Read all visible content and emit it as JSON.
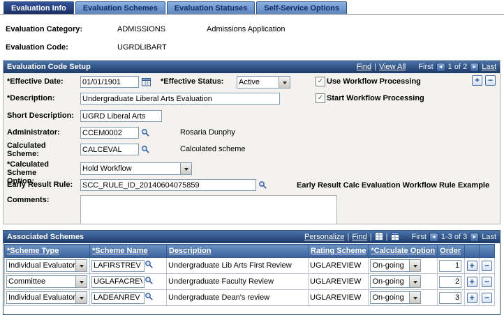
{
  "ui": {
    "sep": "|"
  },
  "icons": {
    "prev": "◄",
    "next": "►",
    "add": "+",
    "remove": "−",
    "check": "✓"
  },
  "colors": {
    "tab_active_bg": "#1f3a6e",
    "bar_gradient_top": "#4a74ab",
    "bar_gradient_bottom": "#1d3a66",
    "grid_header_bg": "#3b639d",
    "input_border": "#7f9db9",
    "groupbox_bg": "#f3f2ee"
  },
  "tabs": [
    {
      "label": "Evaluation Info"
    },
    {
      "label": "Evaluation Schemes"
    },
    {
      "label": "Evaluation Statuses"
    },
    {
      "label": "Self-Service Options"
    }
  ],
  "summary": {
    "category_label": "Evaluation Category:",
    "category_value": "ADMISSIONS",
    "category_desc": "Admissions Application",
    "code_label": "Evaluation Code:",
    "code_value": "UGRDLIBART"
  },
  "setup": {
    "title": "Evaluation Code Setup",
    "find": "Find",
    "view_all": "View All",
    "first": "First",
    "position": "1 of 2",
    "last": "Last",
    "effective_date": {
      "label": "*Effective Date:",
      "value": "01/01/1901"
    },
    "effective_status": {
      "label": "*Effective Status:",
      "value": "Active"
    },
    "use_workflow": "Use Workflow Processing",
    "start_workflow": "Start Workflow Processing",
    "description": {
      "label": "*Description:",
      "value": "Undergraduate Liberal Arts Evaluation"
    },
    "short_description": {
      "label": "Short Description:",
      "value": "UGRD Liberal Arts"
    },
    "administrator": {
      "label": "Administrator:",
      "value": "CCEM0002",
      "display": "Rosaria Dunphy"
    },
    "calculated_scheme": {
      "label": "Calculated Scheme:",
      "value": "CALCEVAL",
      "display": "Calculated scheme"
    },
    "calculated_scheme_option": {
      "label": "*Calculated Scheme Option:",
      "value": "Hold Workflow"
    },
    "early_result_rule": {
      "label": "Early Result Rule:",
      "value": "SCC_RULE_ID_20140604075859",
      "display": "Early Result Calc Evaluation Workflow Rule Example"
    },
    "comments_label": "Comments:"
  },
  "grid": {
    "title": "Associated Schemes",
    "personalize": "Personalize",
    "find": "Find",
    "first": "First",
    "position": "1-3 of 3",
    "last": "Last",
    "columns": {
      "scheme_type": "*Scheme Type",
      "scheme_name": "*Scheme Name",
      "description": "Description",
      "rating_scheme": "Rating Scheme",
      "calculate_option": "*Calculate Option",
      "order": "Order"
    },
    "rows": [
      {
        "scheme_type": "Individual Evaluator",
        "scheme_name": "LAFIRSTREV",
        "description": "Undergraduate Lib Arts First Review",
        "rating_scheme": "UGLAREVIEW",
        "calculate_option": "On-going",
        "order": "1"
      },
      {
        "scheme_type": "Committee",
        "scheme_name": "UGLAFACREV",
        "description": "Undergraduate Faculty Review",
        "rating_scheme": "UGLAREVIEW",
        "calculate_option": "On-going",
        "order": "2"
      },
      {
        "scheme_type": "Individual Evaluator",
        "scheme_name": "LADEANREV",
        "description": "Undergraduate Dean's review",
        "rating_scheme": "UGLAREVIEW",
        "calculate_option": "On-going",
        "order": "3"
      }
    ]
  }
}
